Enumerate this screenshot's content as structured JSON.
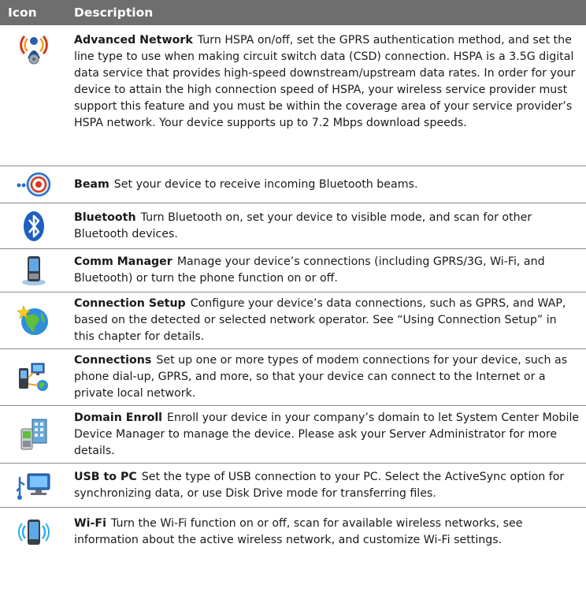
{
  "header": {
    "icon_col": "Icon",
    "desc_col": "Description"
  },
  "rows": [
    {
      "name": "Advanced Network",
      "icon": "advanced-network-icon",
      "text": "Turn HSPA on/off, set the GPRS authentication method, and set the line type to use when making circuit switch data (CSD) connection. HSPA is a 3.5G digital data service that provides high-speed downstream/upstream data rates. In order for your device to attain the high connection speed of HSPA, your wireless service provider must support this feature and you must be within the coverage area of your service provider’s HSPA network. Your device supports up to 7.2 Mbps download speeds."
    },
    {
      "name": "Beam",
      "icon": "beam-icon",
      "text": "Set your device to receive incoming Bluetooth beams."
    },
    {
      "name": "Bluetooth",
      "icon": "bluetooth-icon",
      "text": "Turn Bluetooth on, set your device to visible mode, and scan for other Bluetooth devices."
    },
    {
      "name": "Comm Manager",
      "icon": "comm-manager-icon",
      "text": "Manage your device’s connections (including GPRS/3G, Wi-Fi, and Bluetooth) or turn the phone function on or off."
    },
    {
      "name": "Connection Setup",
      "icon": "connection-setup-icon",
      "text": "Configure your device’s data connections, such as GPRS, and WAP, based on the detected or selected network operator. See “Using Connection Setup” in this chapter for details."
    },
    {
      "name": "Connections",
      "icon": "connections-icon",
      "text": "Set up one or more types of modem connections for your device, such as phone dial-up, GPRS, and more, so that your device can connect to the Internet or a private local network."
    },
    {
      "name": "Domain Enroll",
      "icon": "domain-enroll-icon",
      "text": "Enroll your device in your company’s domain to let System Center Mobile Device Manager to manage the device. Please ask your Server Administrator for more details."
    },
    {
      "name": "USB to PC",
      "icon": "usb-to-pc-icon",
      "text": "Set the type of USB connection to your PC. Select the ActiveSync option for synchronizing data, or use Disk Drive mode for transferring files."
    },
    {
      "name": "Wi-Fi",
      "icon": "wifi-icon",
      "text": "Turn the Wi-Fi function on or off, scan for available wireless networks, see information about the active wireless network, and customize Wi-Fi settings."
    }
  ]
}
